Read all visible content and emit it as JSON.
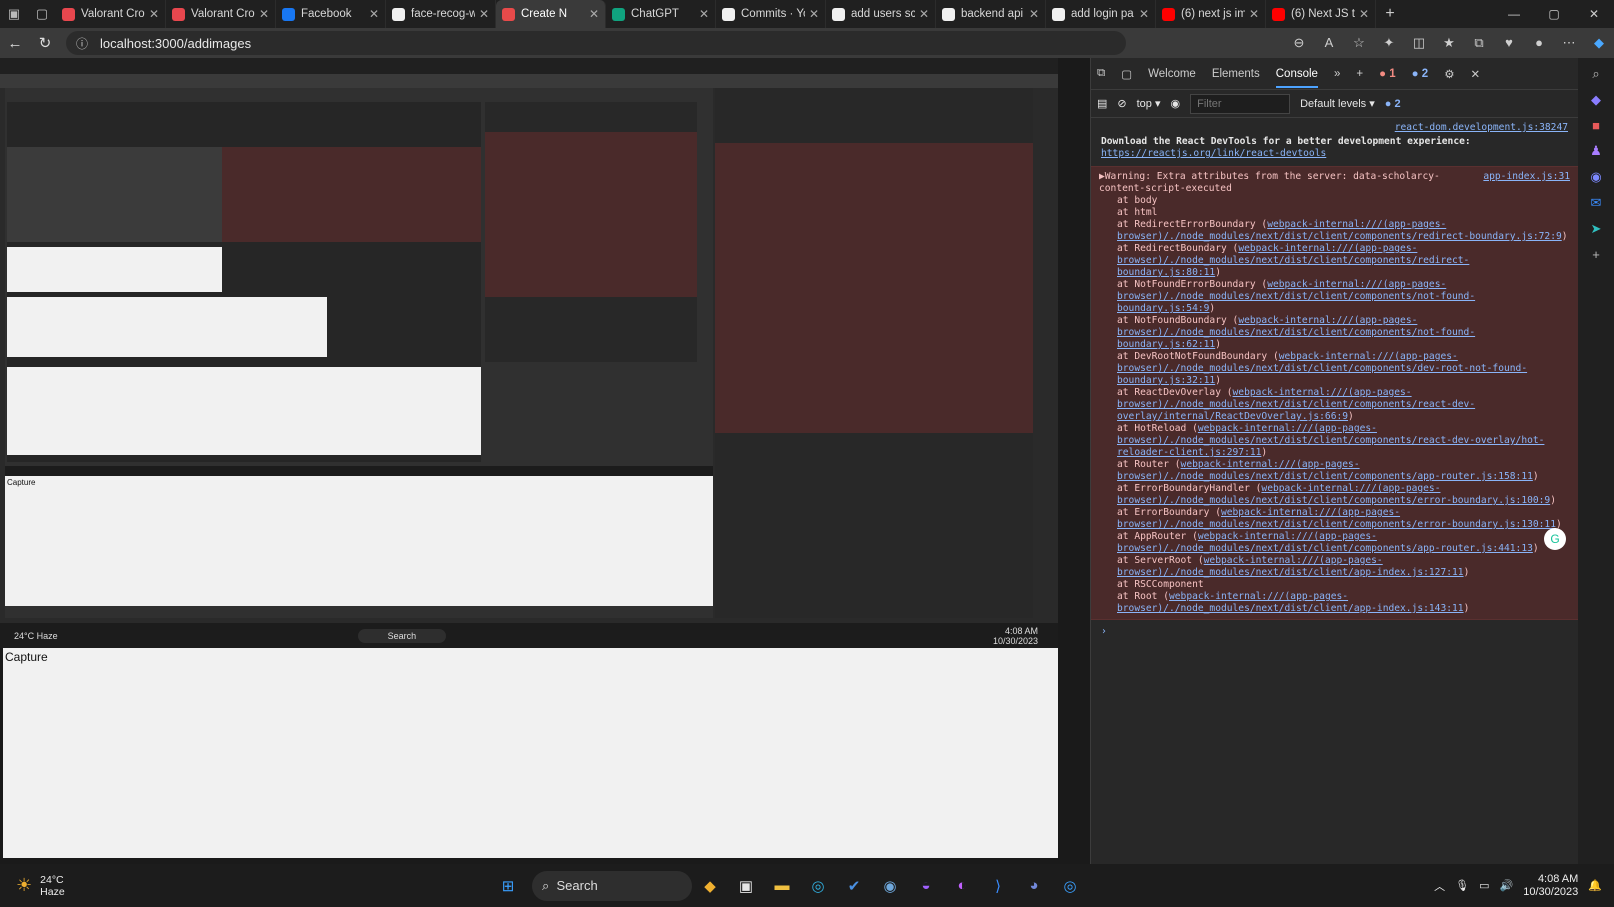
{
  "browser": {
    "tabs": [
      {
        "label": "Valorant Cro",
        "icon": "valorant-icon",
        "color": "#e8474e"
      },
      {
        "label": "Valorant Cro",
        "icon": "valorant-icon",
        "color": "#e8474e"
      },
      {
        "label": "Facebook",
        "icon": "facebook-icon",
        "color": "#1877f2"
      },
      {
        "label": "face-recog-w",
        "icon": "github-icon",
        "color": "#f0f0f0"
      },
      {
        "label": "Create N",
        "icon": "app-icon",
        "color": "#e84a4a",
        "active": true
      },
      {
        "label": "ChatGPT",
        "icon": "chatgpt-icon",
        "color": "#10a37f"
      },
      {
        "label": "Commits · Yo",
        "icon": "github-icon",
        "color": "#f0f0f0"
      },
      {
        "label": "add users sc",
        "icon": "github-icon",
        "color": "#f0f0f0"
      },
      {
        "label": "backend api",
        "icon": "github-icon",
        "color": "#f0f0f0"
      },
      {
        "label": "add login pa",
        "icon": "github-icon",
        "color": "#f0f0f0"
      },
      {
        "label": "(6) next js im",
        "icon": "youtube-icon",
        "color": "#ff0000"
      },
      {
        "label": "(6) Next JS tu",
        "icon": "youtube-icon",
        "color": "#ff0000"
      }
    ],
    "url": "localhost:3000/addimages"
  },
  "devtools": {
    "tabs": [
      "Welcome",
      "Elements",
      "Console"
    ],
    "active_tab": "Console",
    "errors": "1",
    "warnings": "2",
    "context": "top",
    "filter_placeholder": "Filter",
    "levels": "Default levels",
    "issues": "2",
    "react_source": "react-dom.development.js:38247",
    "react_msg": "Download the React DevTools for a better development experience: ",
    "react_link": "https://reactjs.org/link/react-devtools",
    "warn_source": "app-index.js:31",
    "warn_msg": "Warning: Extra attributes from the server: data-scholarcy-content-script-executed",
    "stack": [
      {
        "text": "at body",
        "link": ""
      },
      {
        "text": "at html",
        "link": ""
      },
      {
        "text": "at RedirectErrorBoundary",
        "link": "webpack-internal:///(app-pages-browser)/./node_modules/next/dist/client/components/redirect-boundary.js:72:9"
      },
      {
        "text": "at RedirectBoundary",
        "link": "webpack-internal:///(app-pages-browser)/./node_modules/next/dist/client/components/redirect-boundary.js:80:11"
      },
      {
        "text": "at NotFoundErrorBoundary",
        "link": "webpack-internal:///(app-pages-browser)/./node_modules/next/dist/client/components/not-found-boundary.js:54:9"
      },
      {
        "text": "at NotFoundBoundary",
        "link": "webpack-internal:///(app-pages-browser)/./node_modules/next/dist/client/components/not-found-boundary.js:62:11"
      },
      {
        "text": "at DevRootNotFoundBoundary",
        "link": "webpack-internal:///(app-pages-browser)/./node_modules/next/dist/client/components/dev-root-not-found-boundary.js:32:11"
      },
      {
        "text": "at ReactDevOverlay",
        "link": "webpack-internal:///(app-pages-browser)/./node_modules/next/dist/client/components/react-dev-overlay/internal/ReactDevOverlay.js:66:9"
      },
      {
        "text": "at HotReload",
        "link": "webpack-internal:///(app-pages-browser)/./node_modules/next/dist/client/components/react-dev-overlay/hot-reloader-client.js:297:11"
      },
      {
        "text": "at Router",
        "link": "webpack-internal:///(app-pages-browser)/./node_modules/next/dist/client/components/app-router.js:158:11"
      },
      {
        "text": "at ErrorBoundaryHandler",
        "link": "webpack-internal:///(app-pages-browser)/./node_modules/next/dist/client/components/error-boundary.js:100:9"
      },
      {
        "text": "at ErrorBoundary",
        "link": "webpack-internal:///(app-pages-browser)/./node_modules/next/dist/client/components/error-boundary.js:130:11"
      },
      {
        "text": "at AppRouter",
        "link": "webpack-internal:///(app-pages-browser)/./node_modules/next/dist/client/components/app-router.js:441:13"
      },
      {
        "text": "at ServerRoot",
        "link": "webpack-internal:///(app-pages-browser)/./node_modules/next/dist/client/app-index.js:127:11"
      },
      {
        "text": "at RSCComponent",
        "link": ""
      },
      {
        "text": "at Root",
        "link": "webpack-internal:///(app-pages-browser)/./node_modules/next/dist/client/app-index.js:143:11"
      }
    ]
  },
  "page": {
    "capture_label": "Capture"
  },
  "taskbar": {
    "temp": "24°C",
    "weather": "Haze",
    "search": "Search",
    "time": "4:08 AM",
    "date": "10/30/2023"
  }
}
